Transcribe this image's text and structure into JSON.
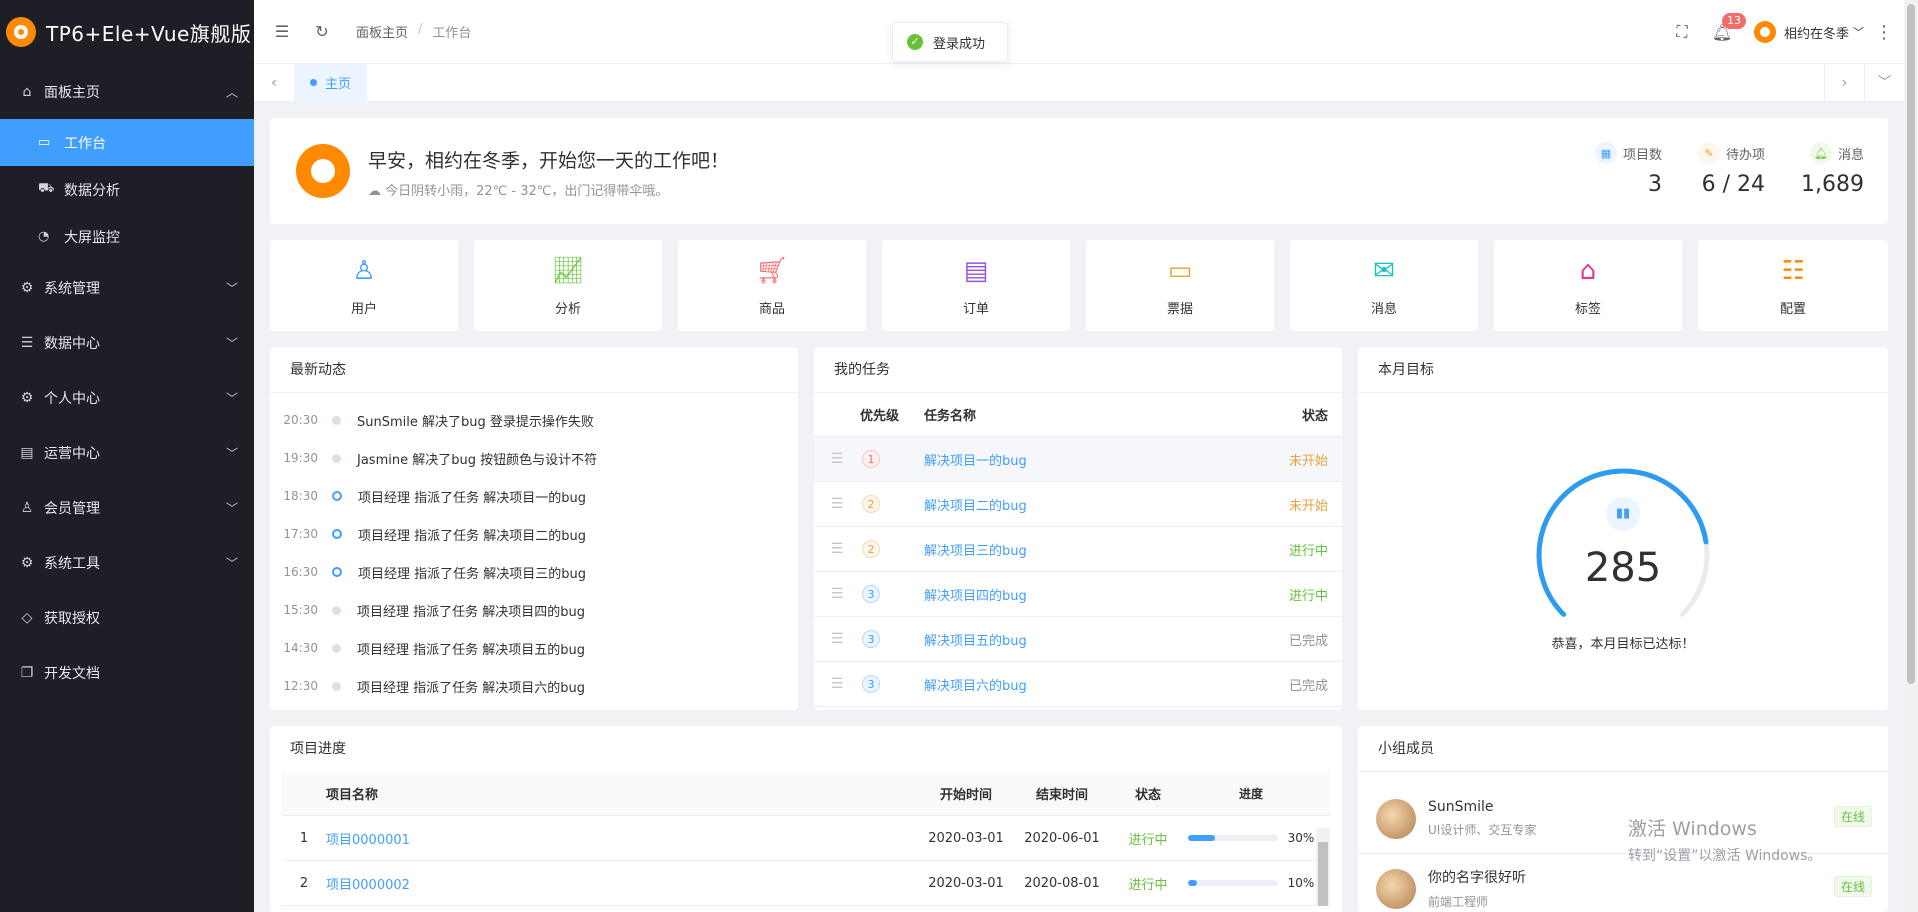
{
  "brand": {
    "title": "TP6+Ele+Vue旗舰版"
  },
  "sidebar": {
    "group_dashboard": "面板主页",
    "dashboard_items": [
      {
        "label": "工作台",
        "icon": "monitor-icon"
      },
      {
        "label": "数据分析",
        "icon": "cart-icon"
      },
      {
        "label": "大屏监控",
        "icon": "gauge-icon"
      }
    ],
    "menus": [
      {
        "label": "系统管理",
        "icon": "gear-icon"
      },
      {
        "label": "数据中心",
        "icon": "database-icon"
      },
      {
        "label": "个人中心",
        "icon": "user-gear-icon"
      },
      {
        "label": "运营中心",
        "icon": "card-icon"
      },
      {
        "label": "会员管理",
        "icon": "member-icon"
      },
      {
        "label": "系统工具",
        "icon": "tools-icon"
      },
      {
        "label": "获取授权",
        "icon": "diamond-icon"
      },
      {
        "label": "开发文档",
        "icon": "document-icon"
      }
    ]
  },
  "header": {
    "breadcrumb": [
      "面板主页",
      "/",
      "工作台"
    ],
    "notification_count": "13",
    "username": "相约在冬季"
  },
  "toast": {
    "message": "登录成功"
  },
  "tabs": [
    {
      "label": "主页"
    }
  ],
  "welcome": {
    "title": "早安，相约在冬季，开始您一天的工作吧！",
    "weather": "今日阴转小雨，22℃ - 32℃，出门记得带伞哦。",
    "stats": [
      {
        "label": "项目数",
        "value": "3"
      },
      {
        "label": "待办项",
        "value": "6 / 24"
      },
      {
        "label": "消息",
        "value": "1,689"
      }
    ]
  },
  "quick_links": [
    {
      "label": "用户",
      "icon": "user-icon",
      "color": "#409eff"
    },
    {
      "label": "分析",
      "icon": "chart-board-icon",
      "color": "#67c23a"
    },
    {
      "label": "商品",
      "icon": "shopping-cart-icon",
      "color": "#f56c6c"
    },
    {
      "label": "订单",
      "icon": "order-icon",
      "color": "#9254de"
    },
    {
      "label": "票据",
      "icon": "ticket-icon",
      "color": "#e6a23c"
    },
    {
      "label": "消息",
      "icon": "mail-icon",
      "color": "#13c2c2"
    },
    {
      "label": "标签",
      "icon": "tag-icon",
      "color": "#eb2f96"
    },
    {
      "label": "配置",
      "icon": "sliders-icon",
      "color": "#fa8c16"
    }
  ],
  "activity": {
    "title": "最新动态",
    "items": [
      {
        "time": "20:30",
        "text": "SunSmile 解决了bug 登录提示操作失败",
        "highlight": false
      },
      {
        "time": "19:30",
        "text": "Jasmine 解决了bug 按钮颜色与设计不符",
        "highlight": false
      },
      {
        "time": "18:30",
        "text": "项目经理 指派了任务 解决项目一的bug",
        "highlight": true
      },
      {
        "time": "17:30",
        "text": "项目经理 指派了任务 解决项目二的bug",
        "highlight": true
      },
      {
        "time": "16:30",
        "text": "项目经理 指派了任务 解决项目三的bug",
        "highlight": true
      },
      {
        "time": "15:30",
        "text": "项目经理 指派了任务 解决项目四的bug",
        "highlight": false
      },
      {
        "time": "14:30",
        "text": "项目经理 指派了任务 解决项目五的bug",
        "highlight": false
      },
      {
        "time": "12:30",
        "text": "项目经理 指派了任务 解决项目六的bug",
        "highlight": false
      }
    ]
  },
  "tasks": {
    "title": "我的任务",
    "columns": [
      "优先级",
      "任务名称",
      "状态"
    ],
    "rows": [
      {
        "priority": "1",
        "name": "解决项目一的bug",
        "status": "未开始",
        "status_color": "#e6a23c"
      },
      {
        "priority": "2",
        "name": "解决项目二的bug",
        "status": "未开始",
        "status_color": "#e6a23c"
      },
      {
        "priority": "2",
        "name": "解决项目三的bug",
        "status": "进行中",
        "status_color": "#67c23a"
      },
      {
        "priority": "3",
        "name": "解决项目四的bug",
        "status": "进行中",
        "status_color": "#67c23a"
      },
      {
        "priority": "3",
        "name": "解决项目五的bug",
        "status": "已完成",
        "status_color": "#909399"
      },
      {
        "priority": "3",
        "name": "解决项目六的bug",
        "status": "已完成",
        "status_color": "#909399"
      }
    ]
  },
  "goal": {
    "title": "本月目标",
    "value": "285",
    "message": "恭喜，本月目标已达标！",
    "progress": 0.8
  },
  "projects": {
    "title": "项目进度",
    "columns": [
      "项目名称",
      "开始时间",
      "结束时间",
      "状态",
      "进度"
    ],
    "rows": [
      {
        "index": "1",
        "name": "项目0000001",
        "start": "2020-03-01",
        "end": "2020-06-01",
        "status": "进行中",
        "progress": 30,
        "progress_label": "30%"
      },
      {
        "index": "2",
        "name": "项目0000002",
        "start": "2020-03-01",
        "end": "2020-08-01",
        "status": "进行中",
        "progress": 10,
        "progress_label": "10%"
      }
    ]
  },
  "members": {
    "title": "小组成员",
    "items": [
      {
        "name": "SunSmile",
        "role": "UI设计师、交互专家",
        "status": "在线"
      },
      {
        "name": "你的名字很好听",
        "role": "前端工程师",
        "status": "在线"
      }
    ]
  },
  "watermark": {
    "line1": "激活 Windows",
    "line2": "转到“设置”以激活 Windows。"
  }
}
